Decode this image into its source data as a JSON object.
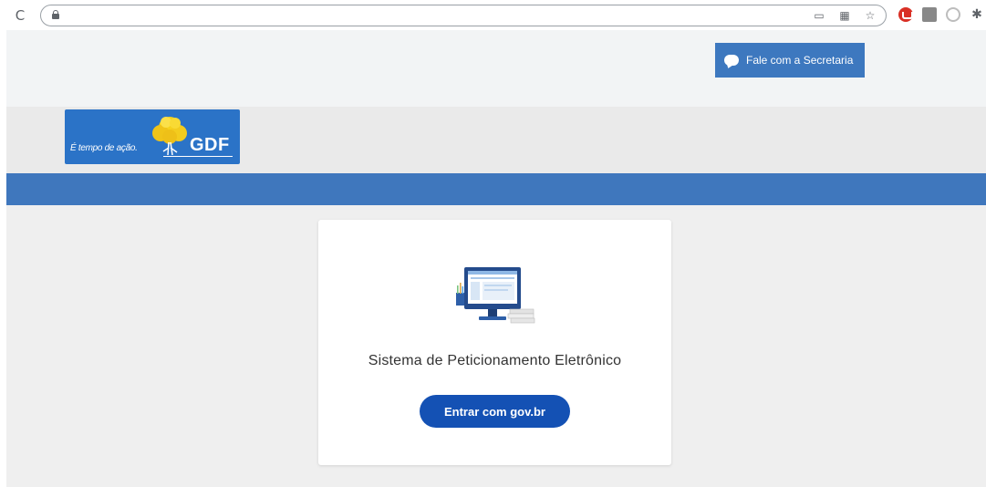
{
  "browser": {
    "reload_glyph": "C",
    "address": "",
    "icons": [
      "cast-icon",
      "qr-icon",
      "star-icon"
    ],
    "extensions": [
      "red-ext-icon",
      "grid-ext-icon",
      "ring-ext-icon",
      "puzzle-icon"
    ]
  },
  "header": {
    "contact_button_label": "Fale com a Secretaria"
  },
  "logo": {
    "slogan": "É tempo de ação.",
    "brand": "GDF"
  },
  "card": {
    "title": "Sistema de Peticionamento Eletrônico",
    "login_button_label": "Entrar com gov.br"
  },
  "colors": {
    "primary_blue": "#3f77bd",
    "govbr_blue": "#1451b4",
    "page_bg": "#efefef"
  }
}
